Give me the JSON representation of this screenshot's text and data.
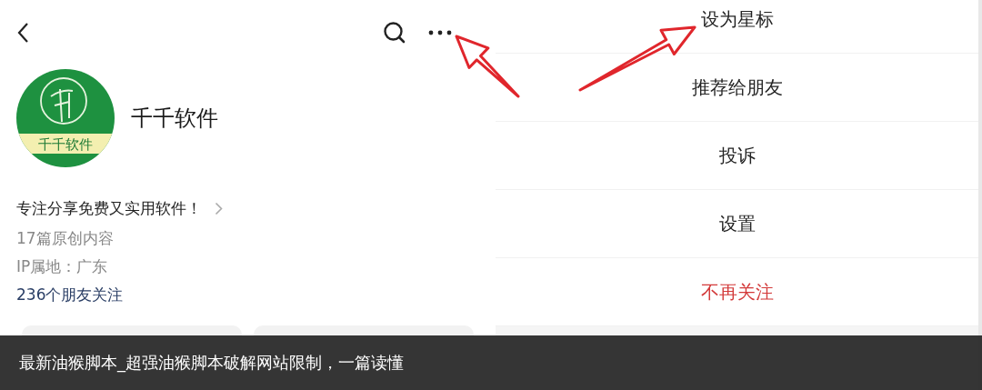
{
  "profile_page": {
    "avatar": {
      "label": "千千软件"
    },
    "name": "千千软件",
    "bio": "专注分享免费又实用软件！",
    "stats": [
      "17篇原创内容",
      "IP属地：广东"
    ],
    "friends": "236个朋友关注",
    "buttons": [
      {
        "kind": "button"
      },
      {
        "kind": "button"
      }
    ]
  },
  "action_sheet": {
    "items": [
      {
        "label": "设为星标",
        "kind": "normal"
      },
      {
        "label": "推荐给朋友",
        "kind": "normal"
      },
      {
        "label": "投诉",
        "kind": "normal"
      },
      {
        "label": "设置",
        "kind": "normal"
      },
      {
        "label": "不再关注",
        "kind": "destructive"
      }
    ]
  },
  "caption": "最新油猴脚本_超强油猴脚本破解网站限制，一篇读懂"
}
